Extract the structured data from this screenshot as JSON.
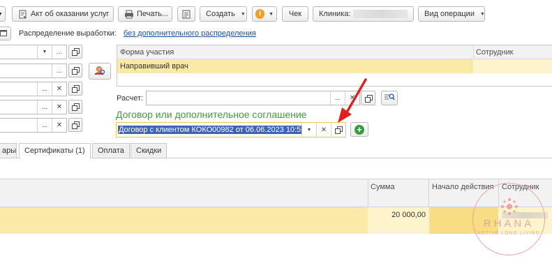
{
  "toolbar": {
    "act_label": "Акт об оказании услуг",
    "print_label": "Печать...",
    "create_label": "Создать",
    "check_label": "Чек",
    "clinic_label": "Клиника:",
    "operation_label": "Вид операции"
  },
  "distribution": {
    "label": "Распределение выработки:",
    "link": "без дополнительного распределения"
  },
  "participation": {
    "col_form": "Форма участия",
    "col_employee": "Сотрудник",
    "rows": [
      {
        "form": "Направивший врач",
        "employee": ""
      }
    ]
  },
  "calc": {
    "label": "Расчет:",
    "value": ""
  },
  "contract": {
    "title": "Договор или дополнительное соглашение",
    "value": "Договор с клиентом КОКО00982 от 06.06.2023 10:5"
  },
  "tabs": [
    {
      "label": "ары",
      "active": false
    },
    {
      "label": "Сертификаты (1)",
      "active": true
    },
    {
      "label": "Оплата",
      "active": false
    },
    {
      "label": "Скидки",
      "active": false
    }
  ],
  "cert_table": {
    "col_sum": "Сумма",
    "col_start": "Начало действия",
    "col_employee": "Сотрудник",
    "rows": [
      {
        "sum": "20 000,00",
        "start": "",
        "employee": ""
      }
    ]
  },
  "watermark": {
    "brand": "RHANA",
    "tagline": "ACTIVE LONG LIVING"
  },
  "colors": {
    "selected_row": "#fbe9a7",
    "row_tint": "#fdf3cc",
    "green_title": "#3e9a3e",
    "highlight": "#3d63b8",
    "arrow": "#e02020",
    "watermark": "#e89a98"
  }
}
